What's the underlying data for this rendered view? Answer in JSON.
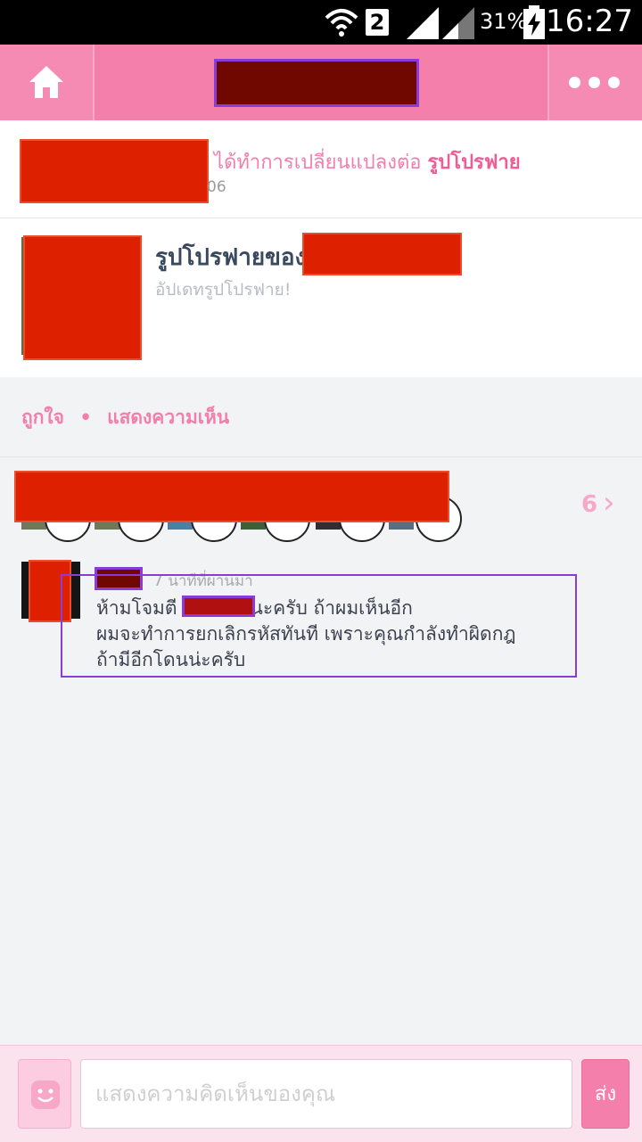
{
  "status_bar": {
    "sim_slot": "2",
    "battery_percent": "31%",
    "time": "16:27"
  },
  "header": {
    "home_icon": "home-icon",
    "more_icon": "more-dots-icon"
  },
  "notification": {
    "action_text": "ได้ทำการเปลี่ยนแปลงต่อ",
    "object_text": "รูปโปรฟาย",
    "time_fragment": "06"
  },
  "profile_card": {
    "title": "รูปโปรฟายของ",
    "subtitle": "อัปเดทรูปโปรฟาย!"
  },
  "actions": {
    "like": "ถูกใจ",
    "separator": "•",
    "comment": "แสดงความเห็น"
  },
  "likes": {
    "count": "6"
  },
  "comment": {
    "time": "7 นาทีที่ผ่านมา",
    "line1_before": "ห้ามโจมตี",
    "line1_after": "นะครับ ถ้าผมเห็นอีก",
    "line2": "ผมจะทำการยกเลิกรหัสทันที เพราะคุณกำลังทำผิดกฎ",
    "line3": "ถ้ามีอีกโดนน่ะครับ"
  },
  "bottom_bar": {
    "emoji_icon": "smiley-icon",
    "input_placeholder": "แสดงความคิดเห็นของคุณ",
    "send_label": "ส่ง"
  },
  "colors": {
    "accent": "#f47fab",
    "redaction": "#dd2100"
  }
}
